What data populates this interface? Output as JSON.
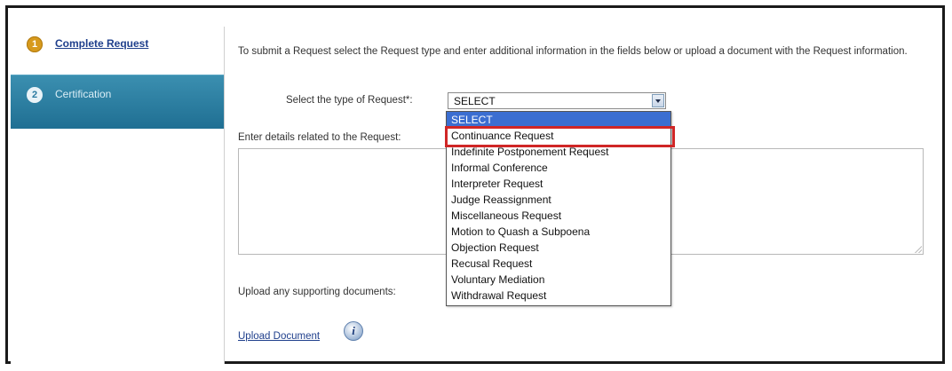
{
  "steps": [
    {
      "number": "1",
      "label": "Complete Request"
    },
    {
      "number": "2",
      "label": "Certification"
    }
  ],
  "intro_text": "To submit a Request select the Request type and enter additional information in the fields below or upload a document with the Request information.",
  "request_type": {
    "label": "Select the type of Request*:",
    "value": "SELECT"
  },
  "details": {
    "label": "Enter details related to the Request:",
    "value": ""
  },
  "upload": {
    "label": "Upload any supporting documents:",
    "link": "Upload Document",
    "info_icon": "info-icon"
  },
  "dropdown": {
    "selected_index": 0,
    "highlighted_index": 1,
    "options": [
      "SELECT",
      "Continuance Request",
      "Indefinite Postponement Request",
      "Informal Conference",
      "Interpreter Request",
      "Judge Reassignment",
      "Miscellaneous Request",
      "Motion to Quash a Subpoena",
      "Objection Request",
      "Recusal Request",
      "Voluntary Mediation",
      "Withdrawal Request"
    ]
  },
  "colors": {
    "active_step_badge": "#d79a1d",
    "sidebar_selected": "#2a7aa0",
    "link": "#1f3f8c",
    "dropdown_selected": "#3b6ed1",
    "annotation_box": "#d02626"
  }
}
